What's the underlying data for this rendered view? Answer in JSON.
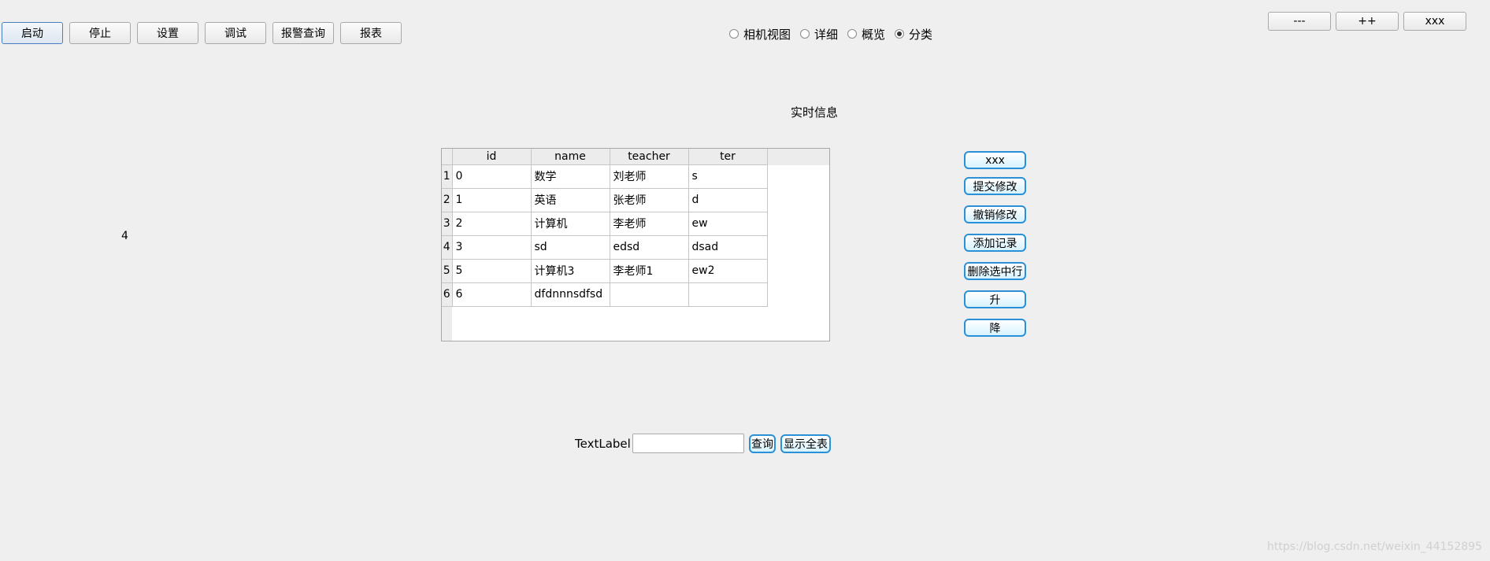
{
  "toolbar": {
    "buttons": [
      "启动",
      "停止",
      "设置",
      "调试",
      "报警查询",
      "报表"
    ]
  },
  "view_modes": {
    "options": [
      "相机视图",
      "详细",
      "概览",
      "分类"
    ],
    "selected": "分类"
  },
  "window_controls": [
    "---",
    "++",
    "xxx"
  ],
  "realtime_title": "实时信息",
  "side_number": "4",
  "table": {
    "columns": [
      "id",
      "name",
      "teacher",
      "ter"
    ],
    "rows": [
      {
        "num": "1",
        "cells": [
          "0",
          "数学",
          "刘老师",
          "s"
        ]
      },
      {
        "num": "2",
        "cells": [
          "1",
          "英语",
          "张老师",
          "d"
        ]
      },
      {
        "num": "3",
        "cells": [
          "2",
          "计算机",
          "李老师",
          "ew"
        ]
      },
      {
        "num": "4",
        "cells": [
          "3",
          "sd",
          "edsd",
          "dsad"
        ]
      },
      {
        "num": "5",
        "cells": [
          "5",
          "计算机3",
          "李老师1",
          "ew2"
        ]
      },
      {
        "num": "6",
        "cells": [
          "6",
          "dfdnnnsdfsd",
          "",
          ""
        ]
      }
    ]
  },
  "actions": [
    "xxx",
    "提交修改",
    "撤销修改",
    "添加记录",
    "删除选中行",
    "升",
    "降"
  ],
  "search": {
    "label": "TextLabel",
    "value": "",
    "query_button": "查询",
    "show_all_button": "显示全表"
  },
  "watermark": "https://blog.csdn.net/weixin_44152895"
}
